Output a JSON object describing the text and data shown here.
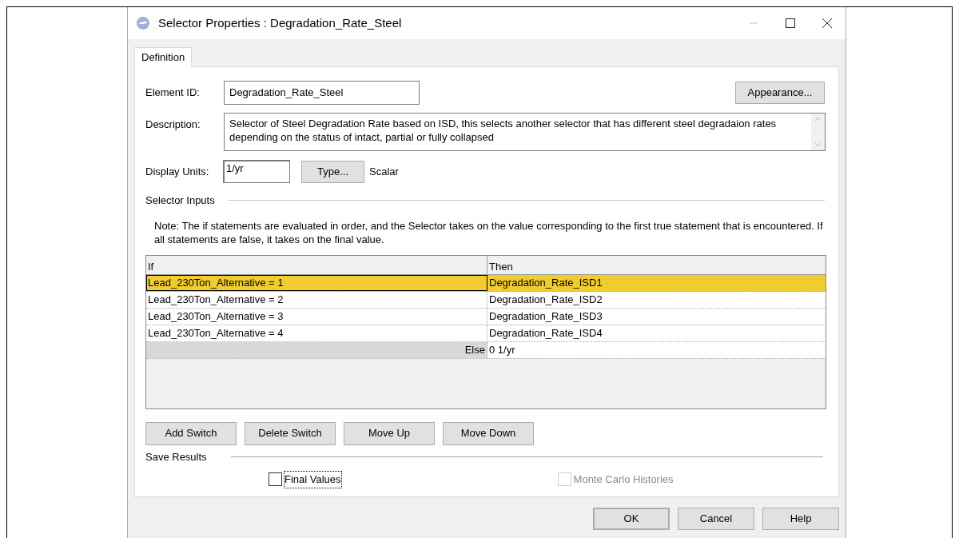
{
  "window": {
    "title": "Selector Properties : Degradation_Rate_Steel"
  },
  "tabs": [
    {
      "label": "Definition",
      "selected": true
    }
  ],
  "element_id": {
    "label": "Element ID:",
    "value": "Degradation_Rate_Steel"
  },
  "appearance_button": {
    "label": "Appearance..."
  },
  "description": {
    "label": "Description:",
    "value": "Selector of Steel Degradation Rate based on ISD, this selects another selector that has different steel degradaion rates depending on the status of intact, partial or fully collapsed"
  },
  "display_units": {
    "label": "Display Units:",
    "value": "1/yr",
    "type_button": "Type...",
    "type_value": "Scalar"
  },
  "selector_inputs": {
    "heading": "Selector Inputs",
    "note": "Note: The if statements are evaluated in order, and the Selector takes on the value corresponding to the first true statement that is encountered. If all statements are false, it takes on the final value."
  },
  "table": {
    "columns": [
      "If",
      "Then"
    ],
    "rows": [
      {
        "if": "Lead_230Ton_Alternative = 1",
        "then": "Degradation_Rate_ISD1",
        "selected": true
      },
      {
        "if": "Lead_230Ton_Alternative = 2",
        "then": "Degradation_Rate_ISD2",
        "selected": false
      },
      {
        "if": "Lead_230Ton_Alternative = 3",
        "then": "Degradation_Rate_ISD3",
        "selected": false
      },
      {
        "if": "Lead_230Ton_Alternative = 4",
        "then": "Degradation_Rate_ISD4",
        "selected": false
      }
    ],
    "else": {
      "label": "Else",
      "value": "0 1/yr"
    }
  },
  "switch_buttons": [
    {
      "label": "Add Switch"
    },
    {
      "label": "Delete Switch"
    },
    {
      "label": "Move Up"
    },
    {
      "label": "Move Down"
    }
  ],
  "save_results": {
    "heading": "Save Results",
    "options": [
      {
        "label": "Final Values",
        "checked": false,
        "disabled": false,
        "focused": true
      },
      {
        "label": "Monte Carlo Histories",
        "checked": false,
        "disabled": true,
        "focused": false
      }
    ]
  },
  "dialog_buttons": [
    {
      "label": "OK",
      "default": true
    },
    {
      "label": "Cancel",
      "default": false
    },
    {
      "label": "Help",
      "default": false
    }
  ]
}
